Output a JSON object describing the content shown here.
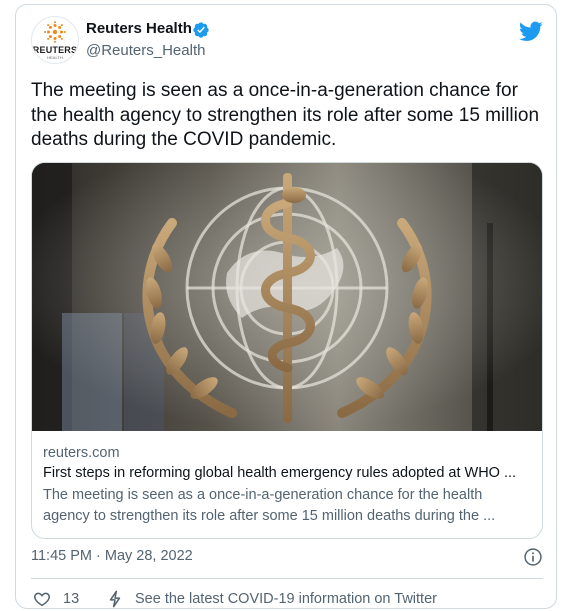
{
  "author": {
    "name": "Reuters Health",
    "handle": "@Reuters_Health",
    "avatar_wordmark": "REUTERS",
    "avatar_subtext": "HEALTH",
    "verified": true
  },
  "tweet": {
    "text": "The meeting is seen as a once-in-a-generation chance for the health agency to strengthen its role after some 15 million deaths during the COVID pandemic.",
    "timestamp": "11:45 PM · May 28, 2022"
  },
  "card": {
    "domain": "reuters.com",
    "title": "First steps in reforming global health emergency rules adopted at WHO ...",
    "description": "The meeting is seen as a once-in-a-generation chance for the health agency to strengthen its role after some 15 million deaths during the ..."
  },
  "footer": {
    "like_count": "13",
    "covid_link": "See the latest COVID-19 information on Twitter"
  },
  "icons": {
    "verified": "verified-badge-icon",
    "brand": "twitter-bird-icon",
    "info": "info-icon",
    "like": "heart-icon",
    "covid": "lightning-bolt-icon"
  },
  "colors": {
    "twitter_blue": "#1d9bf0",
    "text_primary": "#0f1419",
    "text_secondary": "#536471",
    "border": "#cfd9de",
    "reuters_orange": "#f28a19"
  }
}
